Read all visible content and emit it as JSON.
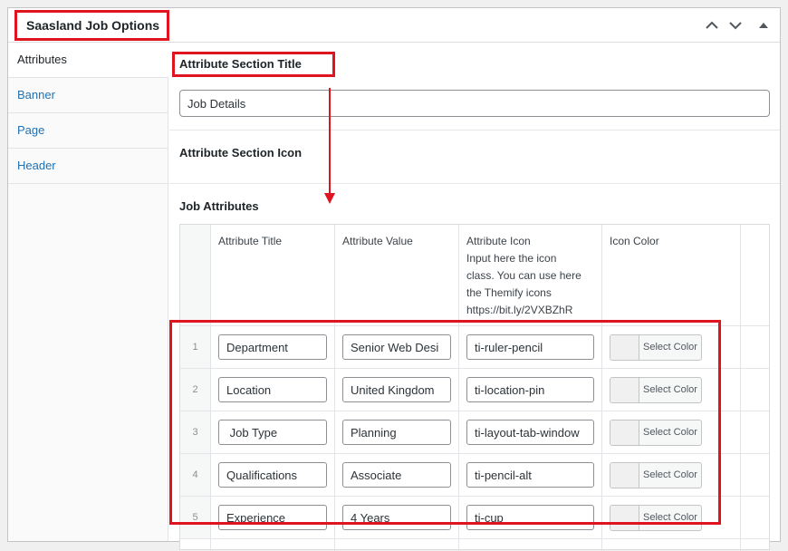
{
  "box": {
    "title": "Saasland Job Options",
    "icons": {
      "move_up": "chevron-up-icon",
      "move_down": "chevron-down-icon",
      "toggle": "triangle-up-icon"
    }
  },
  "tabs": [
    "Attributes",
    "Banner",
    "Page",
    "Header"
  ],
  "active_tab": "Attributes",
  "fields": {
    "section_title_label": "Attribute Section Title",
    "section_title_value": "Job Details",
    "section_icon_label": "Attribute Section Icon",
    "job_attributes_label": "Job Attributes"
  },
  "table": {
    "headers": {
      "title": "Attribute Title",
      "value": "Attribute Value",
      "icon": [
        "Attribute Icon",
        "Input here the icon",
        "class. You can use here",
        "the Themify icons",
        "https://bit.ly/2VXBZhR"
      ],
      "color": "Icon Color"
    },
    "rows": [
      {
        "num": "1",
        "title": "Department",
        "value": "Senior Web Desi",
        "icon": "ti-ruler-pencil",
        "color_btn": "Select Color"
      },
      {
        "num": "2",
        "title": "Location",
        "value": "United Kingdom",
        "icon": "ti-location-pin",
        "color_btn": "Select Color"
      },
      {
        "num": "3",
        "title": " Job Type",
        "value": "Planning",
        "icon": "ti-layout-tab-window",
        "color_btn": "Select Color"
      },
      {
        "num": "4",
        "title": "Qualifications",
        "value": "Associate",
        "icon": "ti-pencil-alt",
        "color_btn": "Select Color"
      },
      {
        "num": "5",
        "title": "Experience",
        "value": "4 Years",
        "icon": "ti-cup",
        "color_btn": "Select Color"
      }
    ]
  },
  "colors": {
    "highlight": "#e0141e",
    "link": "#2271b1"
  }
}
